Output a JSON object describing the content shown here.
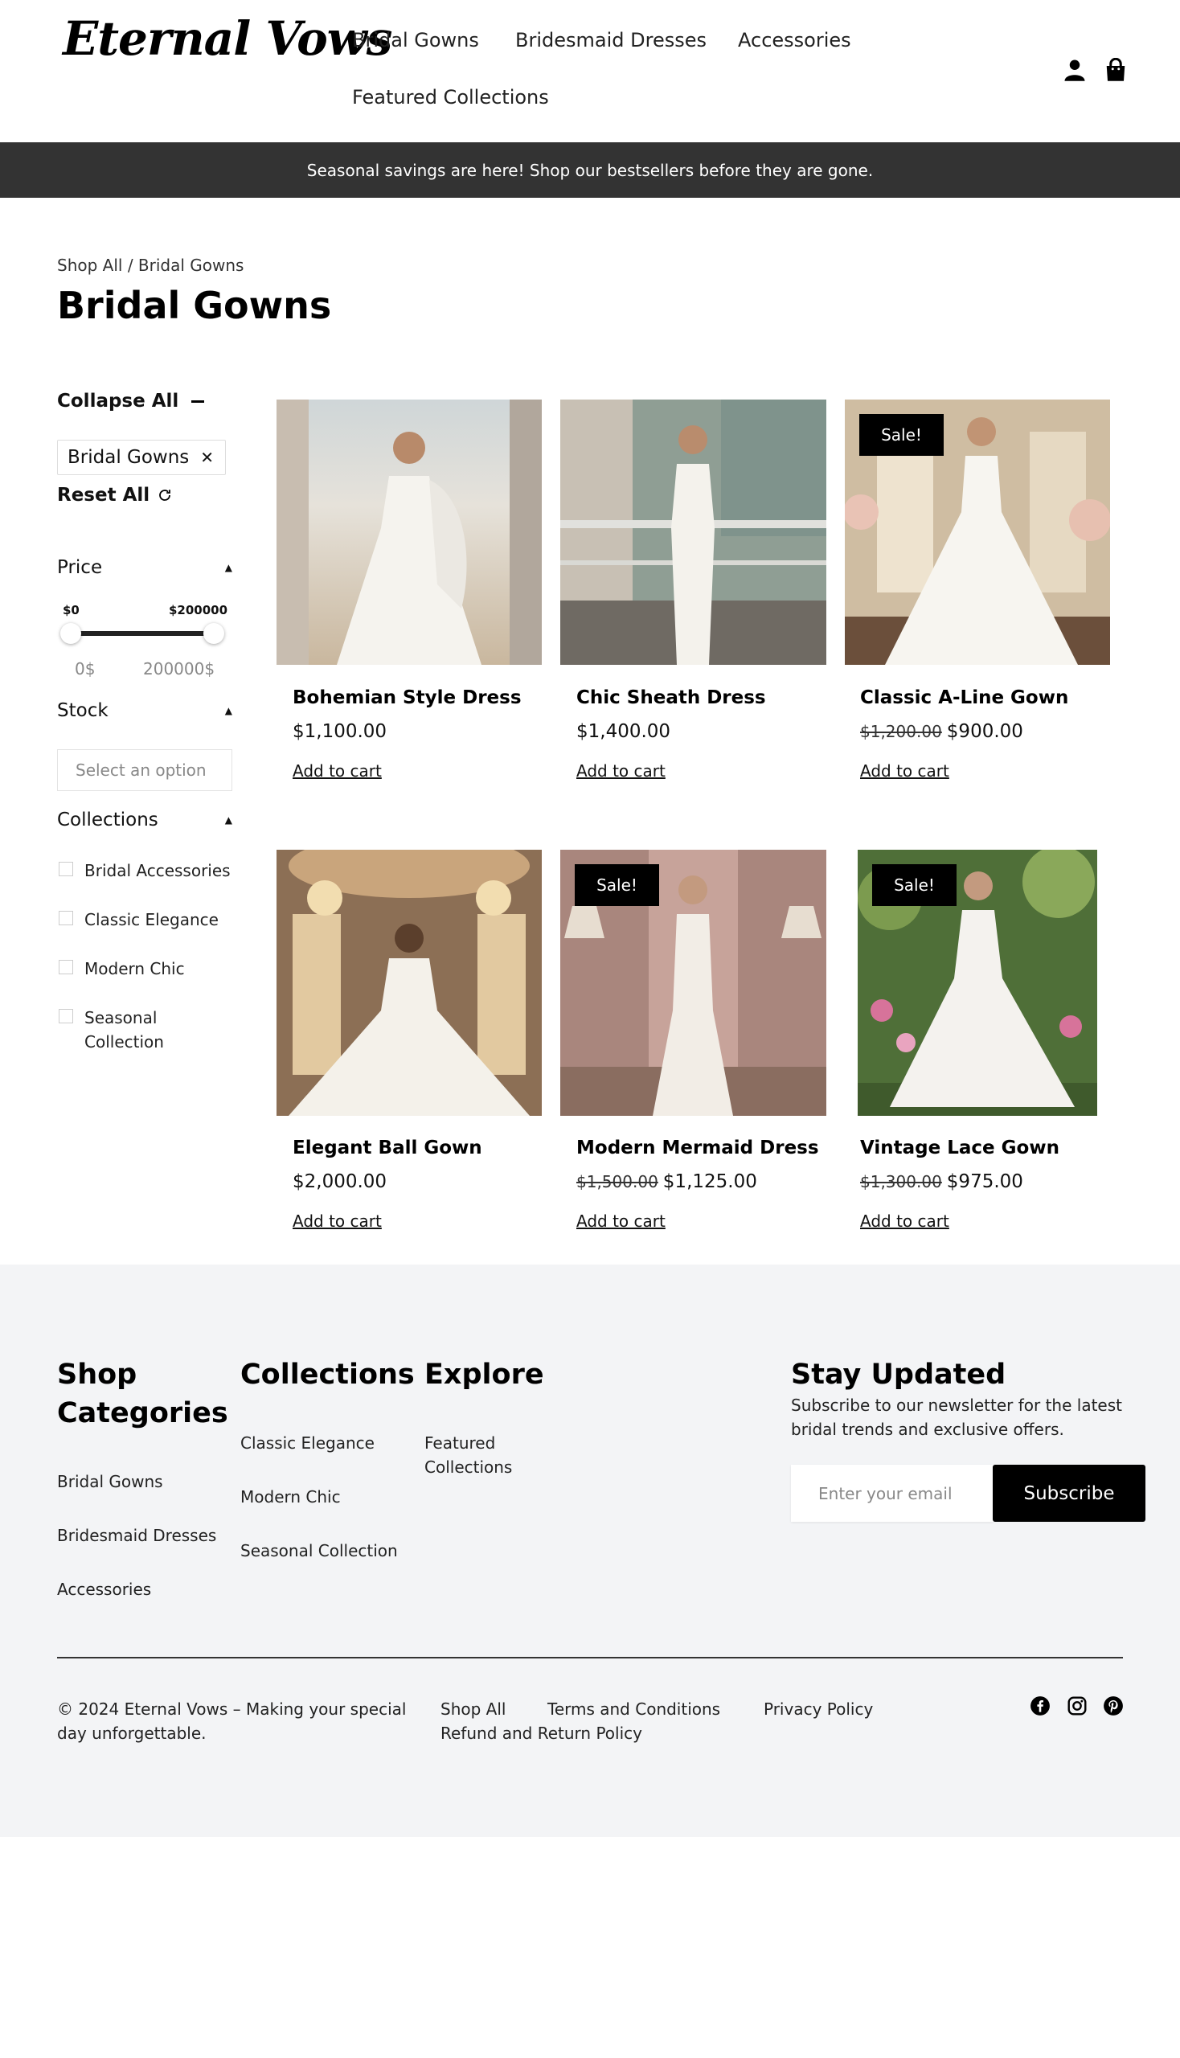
{
  "header": {
    "logo": "Eternal Vows",
    "nav": [
      "Bridal Gowns",
      "Bridesmaid Dresses",
      "Accessories",
      "Featured Collections"
    ],
    "icons": [
      "user-icon",
      "bag-icon"
    ]
  },
  "banner": {
    "text": "Seasonal savings are here! Shop our bestsellers before they are gone."
  },
  "breadcrumb": {
    "root": "Shop All",
    "separator": " / ",
    "current": "Bridal Gowns"
  },
  "page_title": "Bridal Gowns",
  "sidebar": {
    "collapse_all": "Collapse All",
    "active_filter": "Bridal Gowns",
    "reset_all": "Reset All",
    "price": {
      "label": "Price",
      "min_display": "$0",
      "max_display": "$200000",
      "min_value": "0$",
      "max_value": "200000$",
      "range_min": 0,
      "range_max": 200000,
      "selected_min": 0,
      "selected_max": 200000
    },
    "stock": {
      "label": "Stock",
      "placeholder": "Select an option"
    },
    "collections": {
      "label": "Collections",
      "options": [
        "Bridal Accessories",
        "Classic Elegance",
        "Modern Chic",
        "Seasonal Collection"
      ]
    }
  },
  "products": [
    {
      "name": "Bohemian Style Dress",
      "price": "$1,100.00",
      "old_price": "",
      "sale": false,
      "cta": "Add to cart"
    },
    {
      "name": "Chic Sheath Dress",
      "price": "$1,400.00",
      "old_price": "",
      "sale": false,
      "cta": "Add to cart"
    },
    {
      "name": "Classic A-Line Gown",
      "price": "$900.00",
      "old_price": "$1,200.00",
      "sale": true,
      "badge": "Sale!",
      "cta": "Add to cart"
    },
    {
      "name": "Elegant Ball Gown",
      "price": "$2,000.00",
      "old_price": "",
      "sale": false,
      "cta": "Add to cart"
    },
    {
      "name": "Modern Mermaid Dress",
      "price": "$1,125.00",
      "old_price": "$1,500.00",
      "sale": true,
      "badge": "Sale!",
      "cta": "Add to cart"
    },
    {
      "name": "Vintage Lace Gown",
      "price": "$975.00",
      "old_price": "$1,300.00",
      "sale": true,
      "badge": "Sale!",
      "cta": "Add to cart"
    }
  ],
  "footer": {
    "shop_categories": {
      "title": "Shop Categories",
      "links": [
        "Bridal Gowns",
        "Bridesmaid Dresses",
        "Accessories"
      ]
    },
    "collections": {
      "title": "Collections",
      "links": [
        "Classic Elegance",
        "Modern Chic",
        "Seasonal Collection"
      ]
    },
    "explore": {
      "title": "Explore",
      "links": [
        "Featured Collections"
      ]
    },
    "newsletter": {
      "title": "Stay Updated",
      "text": "Subscribe to our newsletter for the latest bridal trends and exclusive offers.",
      "placeholder": "Enter your email",
      "button": "Subscribe"
    },
    "copyright": "© 2024 Eternal Vows – Making your special day unforgettable.",
    "bottom_links": [
      "Shop All",
      "Terms and Conditions",
      "Privacy Policy",
      "Refund and Return Policy"
    ],
    "social_icons": [
      "facebook-icon",
      "instagram-icon",
      "pinterest-icon"
    ]
  },
  "colors": {
    "banner_bg": "#333333",
    "footer_bg": "#f3f4f6",
    "accent": "#000000",
    "muted_text": "#888888"
  }
}
